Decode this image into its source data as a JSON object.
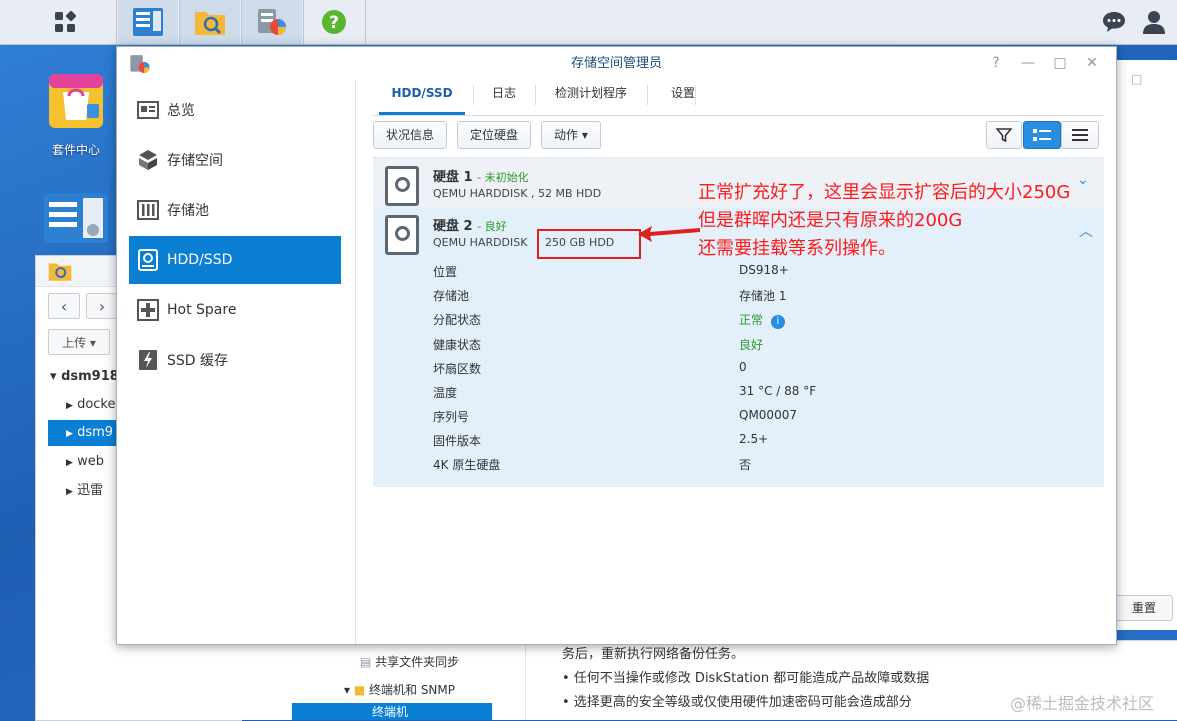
{
  "desktop": {
    "package_center_label": "套件中心"
  },
  "file_window": {
    "upload_label": "上传 ▾",
    "tree_root": "dsm918",
    "tree_items": [
      "docke",
      "dsm9",
      "web",
      "迅雷"
    ],
    "reset_label": "重置",
    "bottom_items": [
      "共享文件夹同步",
      "终端机和 SNMP",
      "终端机"
    ],
    "bottom_text": [
      "务后，重新执行网络备份任务。",
      "• 任何不当操作或修改 DiskStation 都可能造成产品故障或数据",
      "• 选择更高的安全等级或仅使用硬件加速密码可能会造成部分"
    ]
  },
  "window": {
    "title": "存储空间管理员",
    "controls": [
      "?",
      "—",
      "□",
      "✕"
    ]
  },
  "sidebar": {
    "items": [
      {
        "label": "总览",
        "icon": "overview-icon"
      },
      {
        "label": "存储空间",
        "icon": "volume-icon"
      },
      {
        "label": "存储池",
        "icon": "storage-pool-icon"
      },
      {
        "label": "HDD/SSD",
        "icon": "hdd-icon"
      },
      {
        "label": "Hot Spare",
        "icon": "hot-spare-icon"
      },
      {
        "label": "SSD 缓存",
        "icon": "ssd-cache-icon"
      }
    ],
    "active": "HDD/SSD"
  },
  "tabs": [
    "HDD/SSD",
    "日志",
    "检测计划程序",
    "设置"
  ],
  "toolbar": {
    "status_info": "状况信息",
    "locate_disk": "定位硬盘",
    "action": "动作 ▾"
  },
  "disks": [
    {
      "name": "硬盘 1",
      "status": "未初始化",
      "model": "QEMU HARDDISK , 52 MB HDD"
    },
    {
      "name": "硬盘 2",
      "status": "良好",
      "model": "QEMU HARDDISK",
      "size": "250 GB HDD",
      "properties": [
        {
          "label": "位置",
          "value": "DS918+"
        },
        {
          "label": "存储池",
          "value": "存储池 1"
        },
        {
          "label": "分配状态",
          "value": "正常"
        },
        {
          "label": "健康状态",
          "value": "良好"
        },
        {
          "label": "坏扇区数",
          "value": "0"
        },
        {
          "label": "温度",
          "value": "31 °C / 88 °F"
        },
        {
          "label": "序列号",
          "value": "QM00007"
        },
        {
          "label": "固件版本",
          "value": "2.5+"
        },
        {
          "label": "4K 原生硬盘",
          "value": "否"
        }
      ]
    }
  ],
  "annotation": {
    "lines": [
      "正常扩充好了，这里会显示扩容后的大小250G",
      "但是群晖内还是只有原来的200G",
      "还需要挂载等系列操作。"
    ],
    "color": "#ff1a1a"
  },
  "watermark": "@稀土掘金技术社区",
  "colors": {
    "accent": "#0a7fd4",
    "ok": "#2e9a26"
  }
}
